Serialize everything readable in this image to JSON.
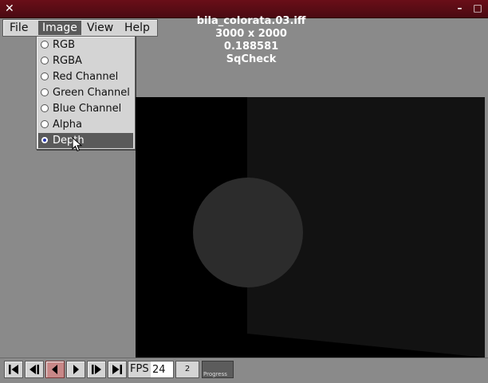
{
  "window": {
    "close_glyph": "✕",
    "title_parts": [
      "bila_colorata.03.iff",
      "3000 x 2000",
      "0.188581",
      "SqCheck"
    ],
    "minimize_glyph": "–",
    "maximize_glyph": "□"
  },
  "menubar": {
    "items": [
      "File",
      "Image",
      "View",
      "Help"
    ],
    "active": "Image"
  },
  "image_menu": {
    "items": [
      {
        "label": "RGB",
        "checked": false
      },
      {
        "label": "RGBA",
        "checked": false
      },
      {
        "label": "Red Channel",
        "checked": false
      },
      {
        "label": "Green Channel",
        "checked": false
      },
      {
        "label": "Blue Channel",
        "checked": false
      },
      {
        "label": "Alpha",
        "checked": false
      },
      {
        "label": "Depth",
        "checked": true
      }
    ]
  },
  "toolbar": {
    "buttons": [
      {
        "icon": "first-frame-icon"
      },
      {
        "icon": "step-back-icon"
      },
      {
        "icon": "play-backward-icon",
        "active": true
      },
      {
        "icon": "play-forward-icon"
      },
      {
        "icon": "step-forward-icon"
      },
      {
        "icon": "last-frame-icon"
      }
    ],
    "fps_label": "FPS",
    "fps_value": "24",
    "frame_value": "2",
    "progress_label": "Progress"
  },
  "colors": {
    "titlebar": "#5a0c14",
    "menu_bg": "#d4d4d4",
    "menu_selected": "#5a5a5a",
    "active_button": "#c88888"
  }
}
